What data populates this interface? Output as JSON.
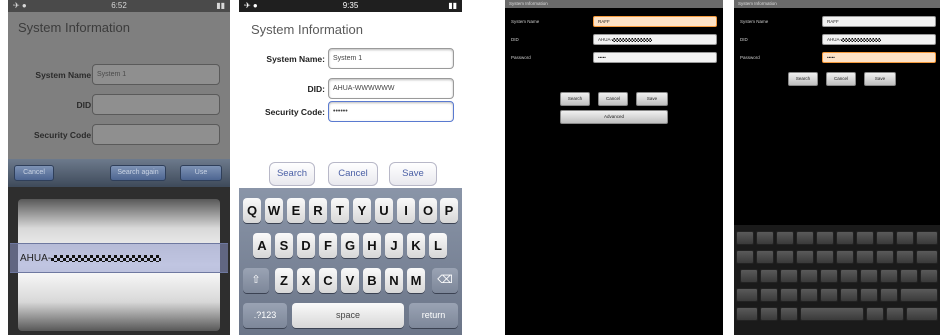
{
  "panel1": {
    "status": {
      "left": "✈ ●",
      "time": "6:52",
      "right": "▮▮"
    },
    "title": "System Information",
    "fields": [
      {
        "label": "System Name:",
        "value": "System 1"
      },
      {
        "label": "DID:",
        "value": ""
      },
      {
        "label": "Security Code:",
        "value": ""
      }
    ],
    "toolbar": {
      "cancel": "Cancel",
      "search_again": "Search again",
      "use": "Use"
    },
    "picker_value": "AHUA-"
  },
  "panel2": {
    "status": {
      "left": "✈ ●",
      "time": "9:35",
      "right": "▮▮"
    },
    "title": "System Information",
    "fields": [
      {
        "label": "System Name:",
        "value": "System 1"
      },
      {
        "label": "DID:",
        "value": "AHUA-WWWWWW"
      },
      {
        "label": "Security Code:",
        "value": "••••••"
      }
    ],
    "buttons": {
      "search": "Search",
      "cancel": "Cancel",
      "save": "Save"
    },
    "keyboard": {
      "row1": [
        "Q",
        "W",
        "E",
        "R",
        "T",
        "Y",
        "U",
        "I",
        "O",
        "P"
      ],
      "row2": [
        "A",
        "S",
        "D",
        "F",
        "G",
        "H",
        "J",
        "K",
        "L"
      ],
      "row3": [
        "Z",
        "X",
        "C",
        "V",
        "B",
        "N",
        "M"
      ],
      "shift": "⇧",
      "backspace": "⌫",
      "numbers": ".?123",
      "space": "space",
      "return": "return"
    }
  },
  "panel3": {
    "status_title": "System Information",
    "fields": [
      {
        "label": "System Name",
        "value": "RAFF"
      },
      {
        "label": "DID",
        "value": "AHUA-"
      },
      {
        "label": "Password",
        "value": "•••••"
      }
    ],
    "buttons": {
      "search": "Search",
      "cancel": "Cancel",
      "save": "Save",
      "advanced": "Advanced"
    }
  },
  "panel4": {
    "status_title": "System Information",
    "fields": [
      {
        "label": "System Name",
        "value": "RAFF"
      },
      {
        "label": "DID",
        "value": "AHUA-"
      },
      {
        "label": "Password",
        "value": "•••••"
      }
    ],
    "buttons": {
      "search": "Search",
      "cancel": "Cancel",
      "save": "Save"
    }
  }
}
